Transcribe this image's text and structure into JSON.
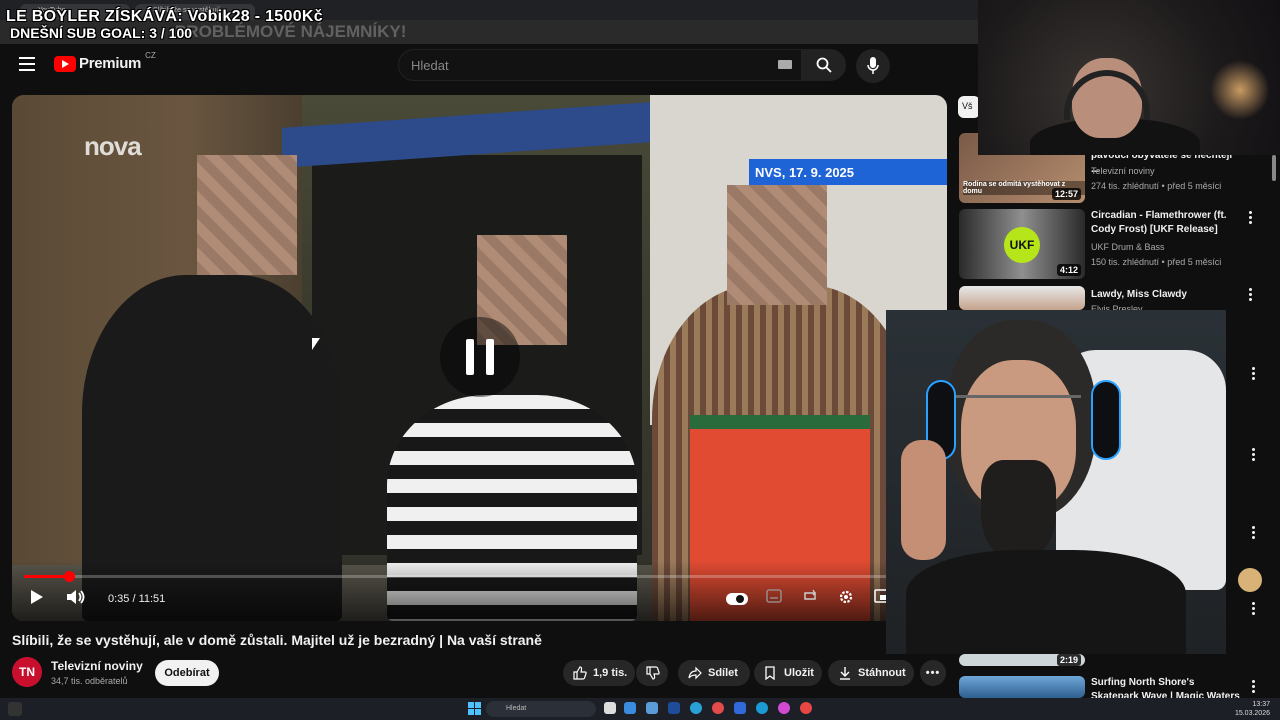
{
  "overlay": {
    "donation": "LE BOYLER ZÍSKÁVÁ: Vobik28 - 1500Kč",
    "sub_goal": "DNEŠNÍ SUB GOAL: 3 / 100",
    "ghost": "PROBLÉMOVÉ NÁJEMNÍKY!"
  },
  "browser": {
    "tabs": [
      "YouTube",
      "Slíbili, že se vystěhují"
    ]
  },
  "header": {
    "logo_word": "Premium",
    "country": "CZ",
    "search_placeholder": "Hledat"
  },
  "video": {
    "channel_watermark": "nova",
    "date_banner": "NVS, 17. 9. 2025",
    "current_time": "0:35",
    "duration": "11:51",
    "time_label": "0:35 / 11:51",
    "progress": 0.049,
    "playing": true
  },
  "meta": {
    "title": "Slíbili, že se vystěhují, ale v domě zůstali. Majitel už je bezradný | Na vaší straně",
    "channel": "Televizní noviny",
    "channel_initials": "TN",
    "subscribers": "34,7 tis. odběratelů",
    "subscribe_label": "Odebírat",
    "likes": "1,9 tis.",
    "share_label": "Sdílet",
    "save_label": "Uložit",
    "download_label": "Stáhnout"
  },
  "sidebar": {
    "chip_label": "Vš",
    "items": [
      {
        "title": "pavoučí obyvatele se nechtějí ...",
        "channel": "Televizní noviny",
        "meta": "274 tis. zhlédnutí • před 5 měsíci",
        "duration": "12:57",
        "thumb_caption": "Rodina se odmítá vystěhovat z domu"
      },
      {
        "title": "Circadian - Flamethrower (ft. Cody Frost) [UKF Release]",
        "channel": "UKF Drum & Bass",
        "meta": "150 tis. zhlédnutí • před 5 měsíci",
        "duration": "4:12",
        "thumb_caption": "UKF"
      },
      {
        "title": "Lawdy, Miss Clawdy",
        "channel": "Elvis Presley",
        "meta": "",
        "duration": "",
        "thumb_caption": ""
      },
      {
        "title": "Surfing North Shore's Skatepark Wave | Magic Waters Ep | DA",
        "channel": "",
        "meta": "",
        "duration": "2:19",
        "thumb_caption": ""
      }
    ]
  },
  "taskbar": {
    "search_placeholder": "Hledat",
    "time": "13:37",
    "date": "15.03.2026"
  },
  "colors": {
    "yt_red": "#ff0000",
    "bg": "#0f0f0f",
    "nvs_blue": "#1f64d6",
    "ukf_green": "#b6e61a"
  }
}
